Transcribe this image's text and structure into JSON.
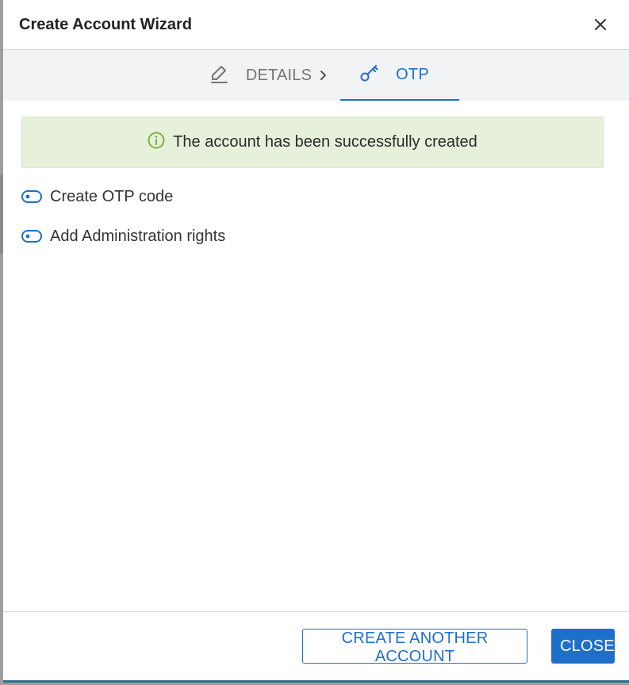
{
  "dialog": {
    "title": "Create Account Wizard",
    "close_icon": "close-icon"
  },
  "stepper": {
    "steps": [
      {
        "label": "DETAILS",
        "icon": "pencil-icon",
        "state": "completed"
      },
      {
        "label": "OTP",
        "icon": "key-icon",
        "state": "active"
      }
    ],
    "separator_icon": "chevron-right-icon"
  },
  "alert": {
    "type": "success",
    "icon": "info-circle-icon",
    "text": "The account has been successfully created"
  },
  "options": [
    {
      "label": "Create OTP code",
      "icon": "toggle-icon",
      "state": "off"
    },
    {
      "label": "Add Administration rights",
      "icon": "toggle-icon",
      "state": "off"
    }
  ],
  "footer": {
    "create_another_label": "CREATE ANOTHER ACCOUNT",
    "close_label": "CLOSE"
  },
  "colors": {
    "accent": "#1e6fcc",
    "success_bg": "#e6f0da",
    "success_icon": "#7cb342",
    "muted_text": "#757575"
  }
}
